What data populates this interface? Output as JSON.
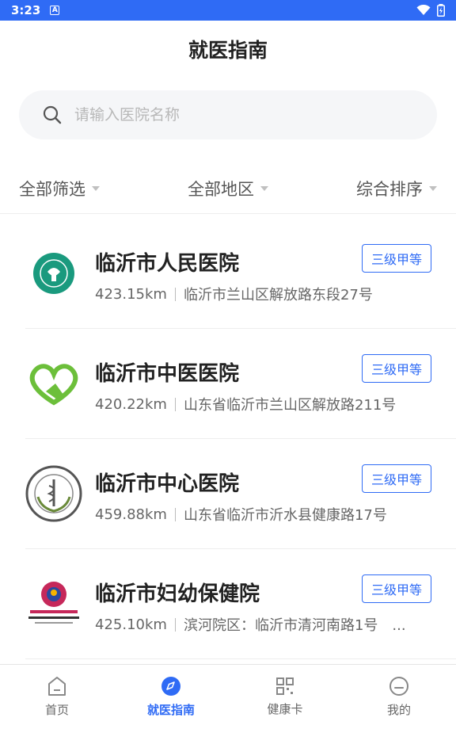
{
  "status_bar": {
    "time": "3:23",
    "notification_icon": "A"
  },
  "header": {
    "title": "就医指南"
  },
  "search": {
    "placeholder": "请输入医院名称"
  },
  "filters": [
    {
      "label": "全部筛选"
    },
    {
      "label": "全部地区"
    },
    {
      "label": "综合排序"
    }
  ],
  "hospitals": [
    {
      "name": "临沂市人民医院",
      "level": "三级甲等",
      "distance": "423.15km",
      "address": "临沂市兰山区解放路东段27号",
      "logo_icon": "linyi-people-hospital-logo-icon"
    },
    {
      "name": "临沂市中医医院",
      "level": "三级甲等",
      "distance": "420.22km",
      "address": "山东省临沂市兰山区解放路211号",
      "logo_icon": "linyi-tcm-hospital-logo-icon"
    },
    {
      "name": "临沂市中心医院",
      "level": "三级甲等",
      "distance": "459.88km",
      "address": "山东省临沂市沂水县健康路17号",
      "logo_icon": "linyi-central-hospital-logo-icon"
    },
    {
      "name": "临沂市妇幼保健院",
      "level": "三级甲等",
      "distance": "425.10km",
      "address": "滨河院区：临沂市清河南路1号　...",
      "logo_icon": "linyi-maternal-child-hospital-logo-icon"
    }
  ],
  "tabbar": [
    {
      "label": "首页",
      "icon": "home-icon",
      "active": false
    },
    {
      "label": "就医指南",
      "icon": "compass-icon",
      "active": true
    },
    {
      "label": "健康卡",
      "icon": "qr-code-icon",
      "active": false
    },
    {
      "label": "我的",
      "icon": "profile-icon",
      "active": false
    }
  ],
  "colors": {
    "accent": "#2f6bf5",
    "text": "#222222",
    "muted": "#666666"
  }
}
